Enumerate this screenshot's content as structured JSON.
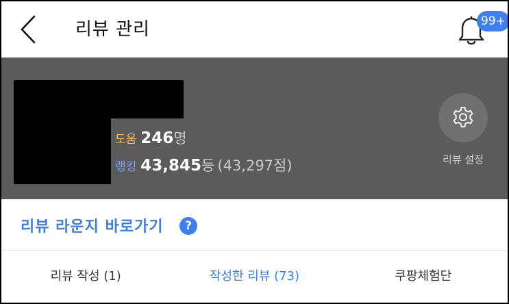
{
  "header": {
    "title": "리뷰 관리",
    "notification_badge": "99+"
  },
  "profile": {
    "help_label": "도움",
    "help_value": "246",
    "help_unit": "명",
    "rank_label": "랭킹",
    "rank_value": "43,845",
    "rank_unit": "등",
    "rank_score": "(43,297점)",
    "settings_label": "리뷰 설정"
  },
  "lounge": {
    "label": "리뷰 라운지 바로가기",
    "help_glyph": "?"
  },
  "tabs": [
    {
      "label": "리뷰 작성 (1)",
      "active": false
    },
    {
      "label": "작성한 리뷰 (73)",
      "active": true
    },
    {
      "label": "쿠팡체험단",
      "active": false
    }
  ],
  "colors": {
    "accent": "#3a7de8",
    "band_gray": "#5b5b5b",
    "help_label": "#f5b942",
    "rank_label": "#7aa6ff"
  }
}
